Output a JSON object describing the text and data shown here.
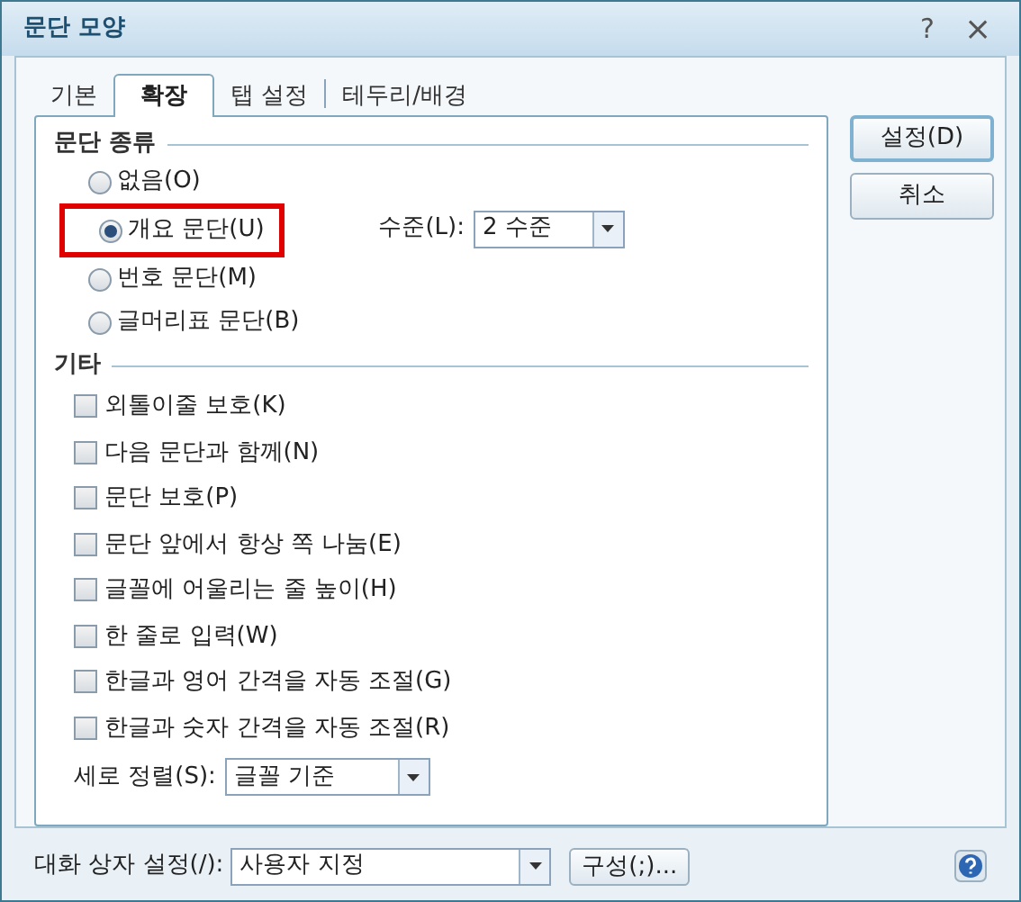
{
  "window": {
    "title": "문단 모양",
    "help_button": "?",
    "close_button": "×"
  },
  "tabs": [
    {
      "label": "기본",
      "selected": false
    },
    {
      "label": "확장",
      "selected": true
    },
    {
      "label": "탭 설정",
      "selected": false
    },
    {
      "label": "테두리/배경",
      "selected": false
    }
  ],
  "paragraph_type": {
    "heading": "문단 종류",
    "options": [
      {
        "label": "없음(O)",
        "selected": false,
        "highlighted": false
      },
      {
        "label": "개요 문단(U)",
        "selected": true,
        "highlighted": true
      },
      {
        "label": "번호 문단(M)",
        "selected": false,
        "highlighted": false
      },
      {
        "label": "글머리표 문단(B)",
        "selected": false,
        "highlighted": false
      }
    ],
    "level_label": "수준(L):",
    "level_value": "2 수준"
  },
  "other": {
    "heading": "기타",
    "checkboxes": [
      {
        "label": "외톨이줄 보호(K)",
        "checked": false
      },
      {
        "label": "다음 문단과 함께(N)",
        "checked": false
      },
      {
        "label": "문단 보호(P)",
        "checked": false
      },
      {
        "label": "문단 앞에서 항상 쪽 나눔(E)",
        "checked": false
      },
      {
        "label": "글꼴에 어울리는 줄 높이(H)",
        "checked": false
      },
      {
        "label": "한 줄로 입력(W)",
        "checked": false
      },
      {
        "label": "한글과 영어 간격을 자동 조절(G)",
        "checked": false
      },
      {
        "label": "한글과 숫자 간격을 자동 조절(R)",
        "checked": false
      }
    ],
    "alignment_label": "세로 정렬(S):",
    "alignment_value": "글꼴 기준"
  },
  "buttons": [
    "설정(D)",
    "취소"
  ],
  "footer": {
    "label": "대화 상자 설정(/):",
    "value": "사용자 지정",
    "configure_button": "구성(;)..."
  }
}
